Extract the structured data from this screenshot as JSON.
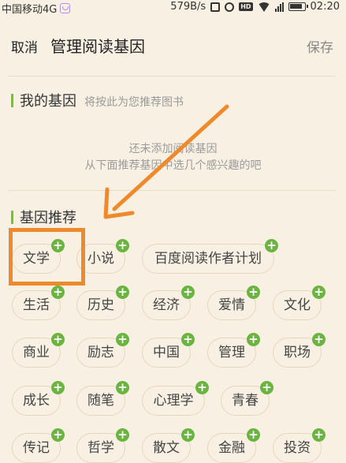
{
  "status_bar": {
    "carrier": "中国移动4G",
    "speed": "579B/s",
    "network_badge": "HD",
    "time": "02:20"
  },
  "header": {
    "cancel_label": "取消",
    "title": "管理阅读基因",
    "save_label": "保存"
  },
  "my_genes": {
    "title": "我的基因",
    "subtitle": "将按此为您推荐图书",
    "empty_line1": "还未添加阅读基因",
    "empty_line2": "从下面推荐基因中选几个感兴趣的吧"
  },
  "recommend": {
    "title": "基因推荐",
    "add_symbol": "+",
    "tags": [
      "文学",
      "小说",
      "百度阅读作者计划",
      "生活",
      "历史",
      "经济",
      "爱情",
      "文化",
      "商业",
      "励志",
      "中国",
      "管理",
      "职场",
      "成长",
      "随笔",
      "心理学",
      "青春",
      "传记",
      "哲学",
      "散文",
      "金融",
      "投资"
    ]
  },
  "colors": {
    "background": "#f8f1e3",
    "accent_green": "#6cb441",
    "annotation_orange": "#ee8a2c"
  }
}
